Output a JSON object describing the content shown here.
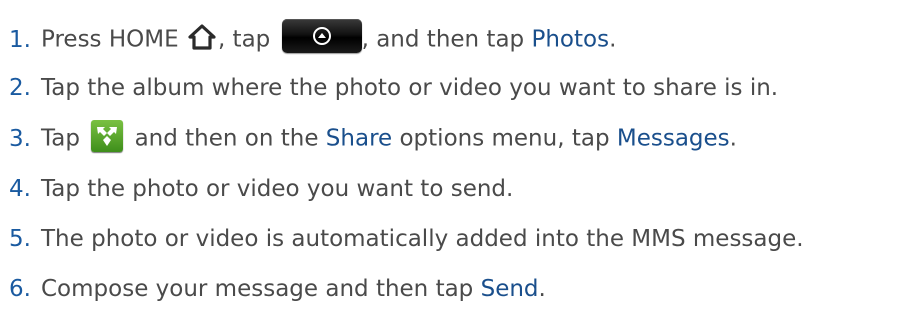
{
  "steps": [
    {
      "num": "1.",
      "t1": "Press HOME",
      "t2": ", tap",
      "t3": ", and then tap",
      "em1": "Photos",
      "t4": "."
    },
    {
      "num": "2.",
      "t1": "Tap the album where the photo or video you want to share is in."
    },
    {
      "num": "3.",
      "t1": "Tap",
      "t2": "and then on the",
      "em1": "Share",
      "t3": "options menu, tap",
      "em2": "Messages",
      "t4": "."
    },
    {
      "num": "4.",
      "t1": "Tap the photo or video you want to send."
    },
    {
      "num": "5.",
      "t1": "The photo or video is automatically added into the MMS message."
    },
    {
      "num": "6.",
      "t1": "Compose your message and then tap",
      "em1": "Send",
      "t2": "."
    }
  ],
  "icons": {
    "home": "home-icon",
    "app_button": "all-apps-button-icon",
    "share": "share-icon"
  },
  "colors": {
    "step_number": "#1a5aa0",
    "emphasis": "#1a4f8c",
    "body_text": "#4a4a4a"
  }
}
